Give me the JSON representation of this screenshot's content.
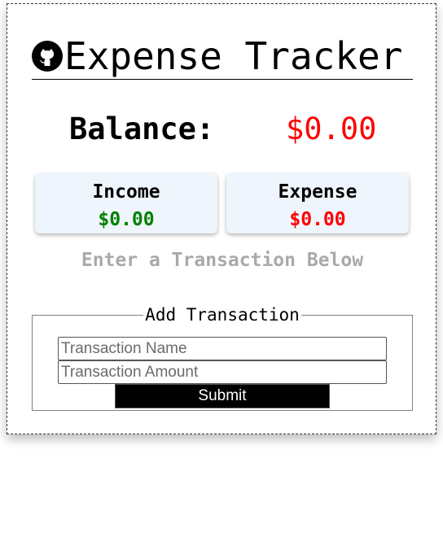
{
  "header": {
    "title": "Expense Tracker",
    "icon": "github-icon"
  },
  "balance": {
    "label": "Balance:",
    "value": "$0.00",
    "value_color": "#ff0000"
  },
  "summary": {
    "income_label": "Income",
    "income_value": "$0.00",
    "income_color": "#008000",
    "expense_label": "Expense",
    "expense_value": "$0.00",
    "expense_color": "#ff0000"
  },
  "hint": "Enter a Transaction Below",
  "form": {
    "legend": "Add Transaction",
    "name_placeholder": "Transaction Name",
    "name_value": "",
    "amount_placeholder": "Transaction Amount",
    "amount_value": "",
    "submit_label": "Submit"
  }
}
